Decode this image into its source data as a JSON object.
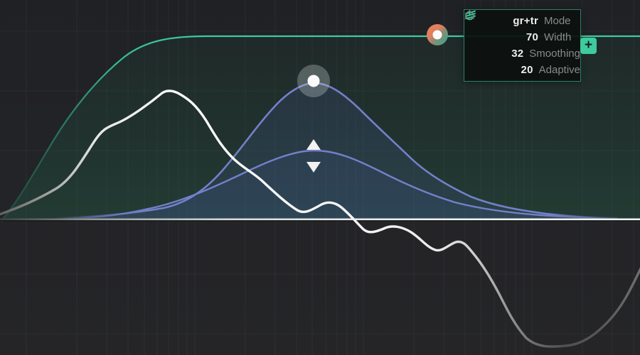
{
  "app": {
    "name": "dynamic-eq-editor"
  },
  "panel": {
    "rows": [
      {
        "icon": "curves-icon",
        "value": "gr+tr",
        "label": "Mode"
      },
      {
        "icon": "power-icon",
        "value": "70",
        "label": "Width"
      },
      {
        "icon": "headphones-icon",
        "value": "32",
        "label": "Smoothing"
      },
      {
        "icon": "",
        "value": "20",
        "label": "Adaptive"
      }
    ]
  },
  "controls": {
    "add_button_label": "+"
  },
  "colors": {
    "accent_teal": "#3cc79d",
    "curve_blue": "#7480ca",
    "node_orange": "#e8815c",
    "spectrum_white": "#f2f2f2",
    "panel_border": "#2d8166",
    "background": "#232427"
  }
}
